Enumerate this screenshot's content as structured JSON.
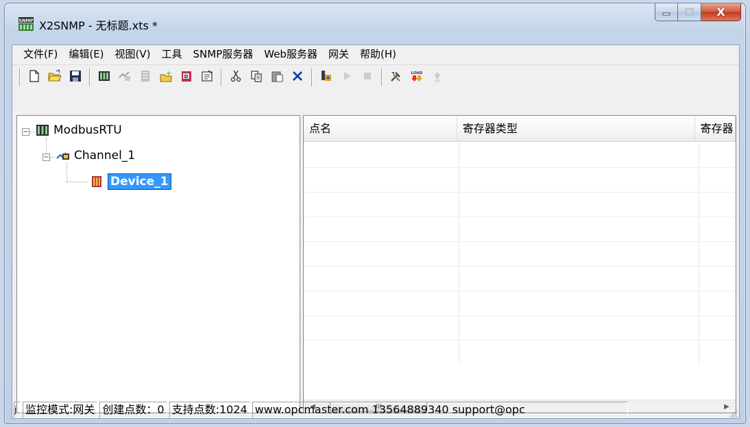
{
  "window": {
    "title": "X2SNMP - 无标题.xts *",
    "app_icon": "snmp-app-icon",
    "caption": {
      "minimize": "minimize-icon",
      "maximize": "maximize-icon",
      "close_glyph": "X"
    }
  },
  "menu": [
    {
      "label": "文件(F)"
    },
    {
      "label": "编辑(E)"
    },
    {
      "label": "视图(V)"
    },
    {
      "label": "工具"
    },
    {
      "label": "SNMP服务器"
    },
    {
      "label": "Web服务器"
    },
    {
      "label": "网关"
    },
    {
      "label": "帮助(H)"
    }
  ],
  "toolbar": {
    "icons": [
      "new-icon",
      "open-icon",
      "save-icon",
      "add-driver-icon",
      "add-channel-icon",
      "add-device-icon",
      "add-point-icon",
      "add-dataset-icon",
      "properties-icon",
      "cut-icon",
      "copy-icon",
      "paste-icon",
      "delete-icon",
      "monitor-icon",
      "run-icon",
      "stop-icon",
      "tools-icon",
      "load-icon",
      "upload-icon"
    ],
    "load_text": "LOAD",
    "upload_text": "UP"
  },
  "tree": {
    "root": {
      "label": "ModbusRTU",
      "expander": "−"
    },
    "channel": {
      "label": "Channel_1",
      "expander": "−"
    },
    "device": {
      "label": "Device_1"
    }
  },
  "list": {
    "columns": [
      "点名",
      "寄存器类型",
      "寄存器"
    ],
    "rows": [],
    "scrollbar": {
      "left_arrow": "◀",
      "right_arrow": "▶",
      "grip": "III"
    }
  },
  "status": {
    "lead": "j",
    "mode": "监控模式:网关",
    "created_points": "创建点数：0",
    "supported_points": "支持点数:1024",
    "contact": "www.opcmaster.com 13564889340 support@opc"
  },
  "colors": {
    "selection": "#3399ff",
    "close_button": "#c23a1e",
    "frame": "#c4d5ea"
  }
}
